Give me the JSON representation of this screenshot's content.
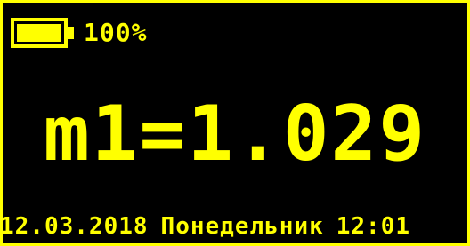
{
  "display": {
    "battery": {
      "level": 1.0,
      "label": "100%"
    },
    "measurement": {
      "text": "m1=1.029"
    },
    "footer": {
      "date": "12.03.2018",
      "weekday": "Понедельник",
      "time": "12:01"
    },
    "colors": {
      "foreground": "#ffff00",
      "background": "#000000"
    }
  }
}
